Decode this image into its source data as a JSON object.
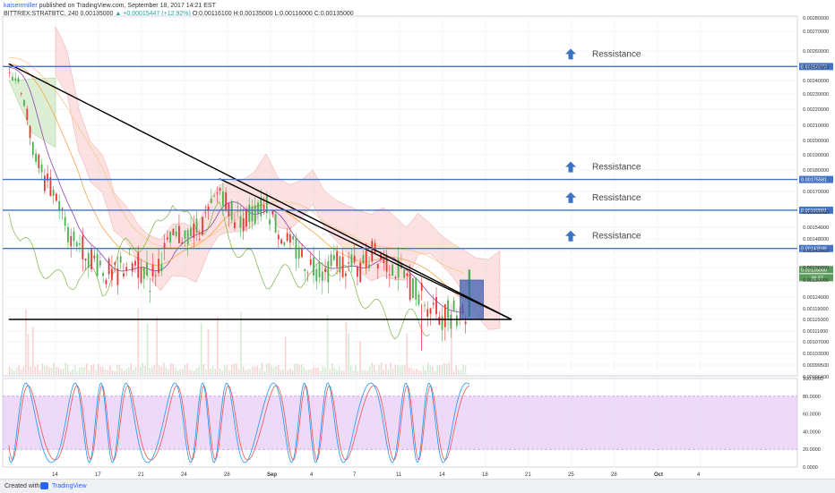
{
  "header": {
    "author": "kaiserrmiller",
    "published": "published on TradingView.com, September 18, 2017 14:21 EST",
    "symbol": "BITTREX:STRATBTC, 240",
    "last": "0.00135000",
    "change": "▲ +0.00015447 (+12.92%)",
    "ohlc": "O:0.00116100 H:0.00135000 L:0.00116000 C:0.00135000"
  },
  "footer": {
    "created_with": "Created with",
    "brand": "TradingView"
  },
  "colors": {
    "up": "#26a69a",
    "down": "#ef5350",
    "candle_up": "#4caf50",
    "candle_down": "#e53935",
    "resistance": "#4472c4",
    "trendline": "#000000",
    "cloud": "#f8c8c8",
    "stoch_band": "#e1c2f5",
    "k_line": "#2196f3",
    "d_line": "#ef5350",
    "price_tag": "#4472c4",
    "current_tag": "#5c9a5c"
  },
  "chart_data": [
    {
      "type": "line",
      "title": "",
      "x_ticks": [
        "14",
        "17",
        "21",
        "24",
        "28",
        "Sep",
        "4",
        "7",
        "11",
        "14",
        "18",
        "21",
        "25",
        "28",
        "Oct",
        "4"
      ],
      "y_ticks": [
        "0.00280000",
        "0.00270000",
        "0.00260000",
        "0.00250000",
        "0.00240000",
        "0.00230000",
        "0.00220000",
        "0.00210000",
        "0.00200000",
        "0.00190000",
        "0.00180000",
        "0.00170000",
        "0.00160000",
        "0.00154000",
        "0.00148000",
        "0.00142000",
        "0.00136000",
        "0.00130000",
        "0.00124000",
        "0.00119000",
        "0.00115000",
        "0.00111000",
        "0.00107000",
        "0.00103000",
        "0.00099500",
        "0.00096400"
      ],
      "resistance_levels": [
        {
          "value": "0.00250373",
          "label": "Ressistance"
        },
        {
          "value": "0.00175581",
          "label": "Ressistance"
        },
        {
          "value": "0.00160901",
          "label": "Ressistance"
        },
        {
          "value": "0.00143046",
          "label": "Ressistance"
        }
      ],
      "current_price": "0.00135000",
      "countdown": "38:37",
      "trendlines": [
        {
          "from": [
            "Aug 10",
            0.00252
          ],
          "to": [
            "Sep 22",
            0.00115
          ]
        },
        {
          "from": [
            "Aug 28",
            0.00176
          ],
          "to": [
            "Sep 22",
            0.00115
          ]
        },
        {
          "from": [
            "Aug 10",
            0.00115
          ],
          "to": [
            "Sep 22",
            0.00115
          ]
        }
      ],
      "grid": true
    },
    {
      "type": "line",
      "title": "",
      "series": [
        {
          "values": []
        },
        {
          "values": []
        }
      ],
      "y_ticks": [
        "100.0000",
        "80.0000",
        "60.0000",
        "40.0000",
        "20.0000",
        "0.0000"
      ],
      "band": [
        20,
        80
      ],
      "ylim": [
        0,
        100
      ]
    }
  ]
}
